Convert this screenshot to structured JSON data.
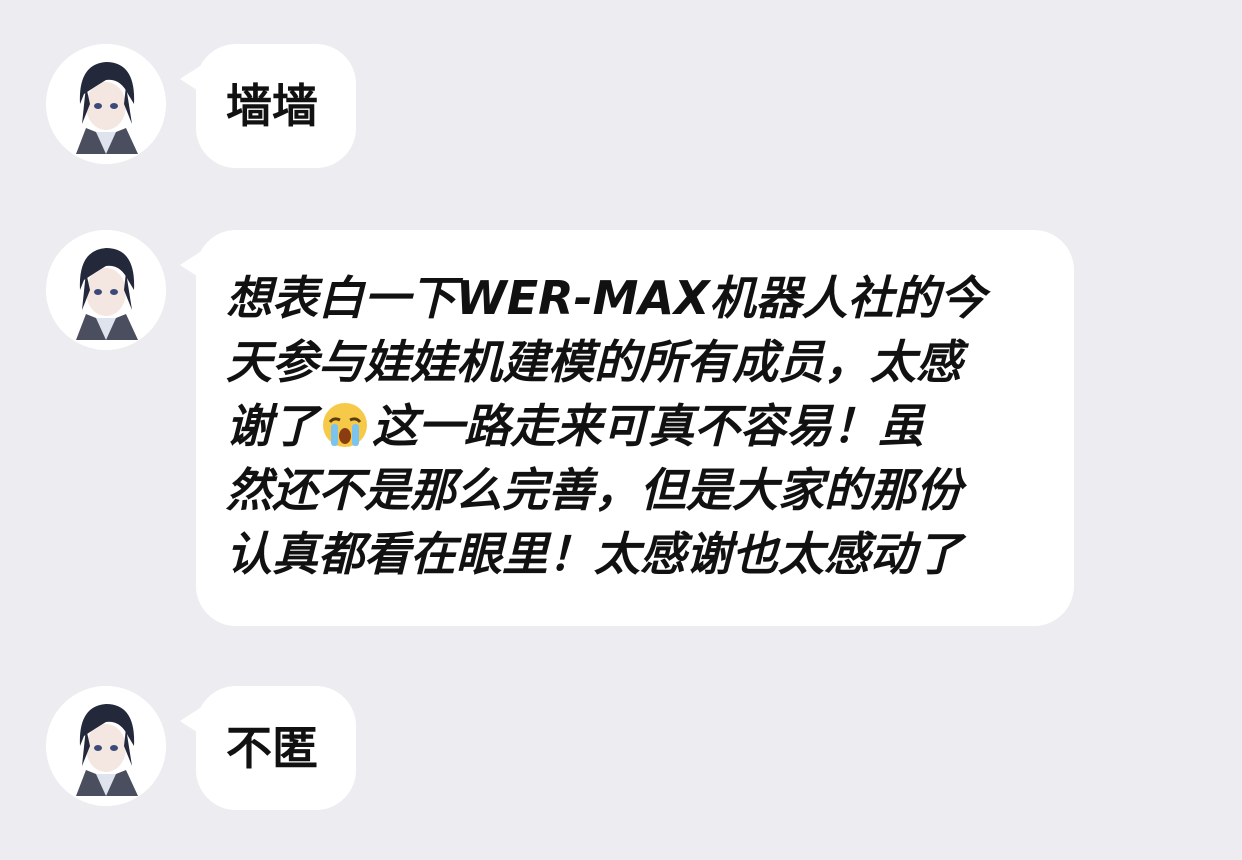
{
  "messages": [
    {
      "text": "墙墙"
    },
    {
      "lines": [
        "想表白一下WER-MAX机器人社的今",
        "天参与娃娃机建模的所有成员，太感",
        "谢了",
        "这一路走来可真不容易！虽",
        "然还不是那么完善，但是大家的那份",
        "认真都看在眼里！太感谢也太感动了"
      ],
      "emoji": "crying-face-emoji"
    },
    {
      "text": "不匿"
    }
  ],
  "colors": {
    "background": "#ededf1",
    "bubble": "#ffffff",
    "text": "#111111"
  }
}
